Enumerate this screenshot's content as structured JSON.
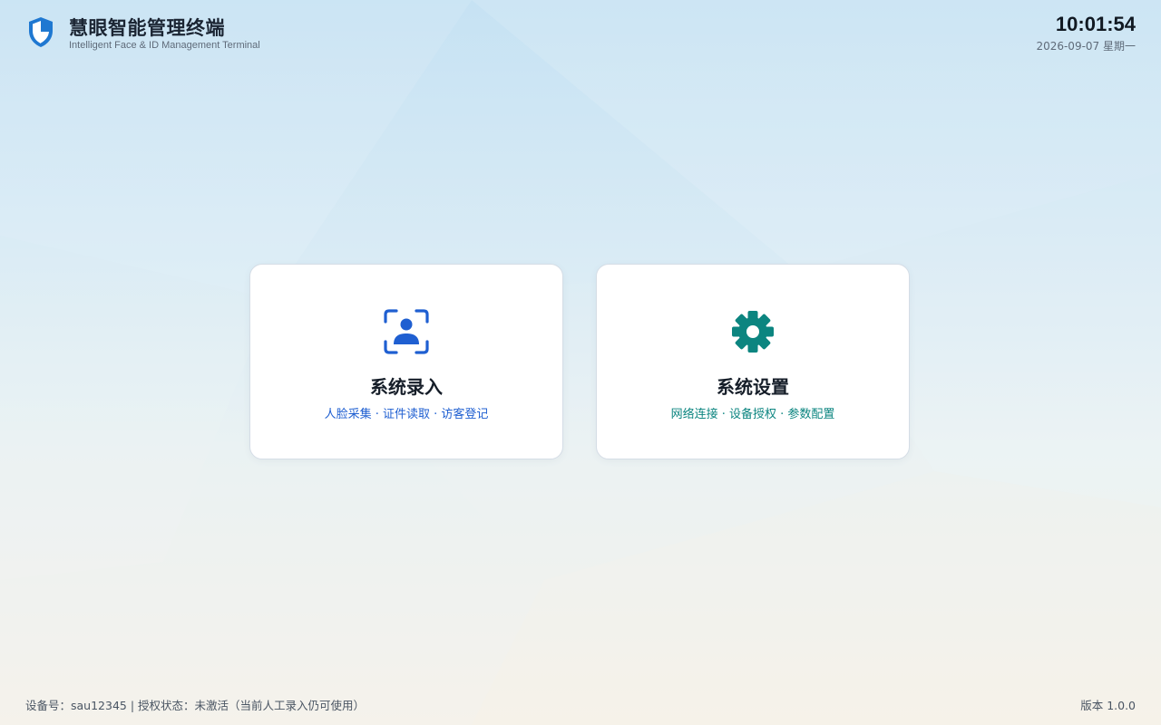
{
  "header": {
    "title": "慧眼智能管理终端",
    "subtitle": "Intelligent Face & ID Management Terminal",
    "time": "10:01:54",
    "date": "2026-09-07 星期一",
    "logo_icon": "shield-icon"
  },
  "cards": [
    {
      "title": "系统录入",
      "description": "人脸采集 · 证件读取 · 访客登记",
      "icon": "face-scan-icon",
      "color": "#1f5fd1"
    },
    {
      "title": "系统设置",
      "description": "网络连接 · 设备授权 · 参数配置",
      "icon": "gear-icon",
      "color": "#0c8580"
    }
  ],
  "footer": {
    "device_info": "设备号：sau12345 | 授权状态：未激活（当前人工录入仍可使用）",
    "version": "版本 1.0.0"
  },
  "colors": {
    "brand_blue": "#1f78d1",
    "card_blue": "#1f5fd1",
    "card_teal": "#0c8580"
  }
}
